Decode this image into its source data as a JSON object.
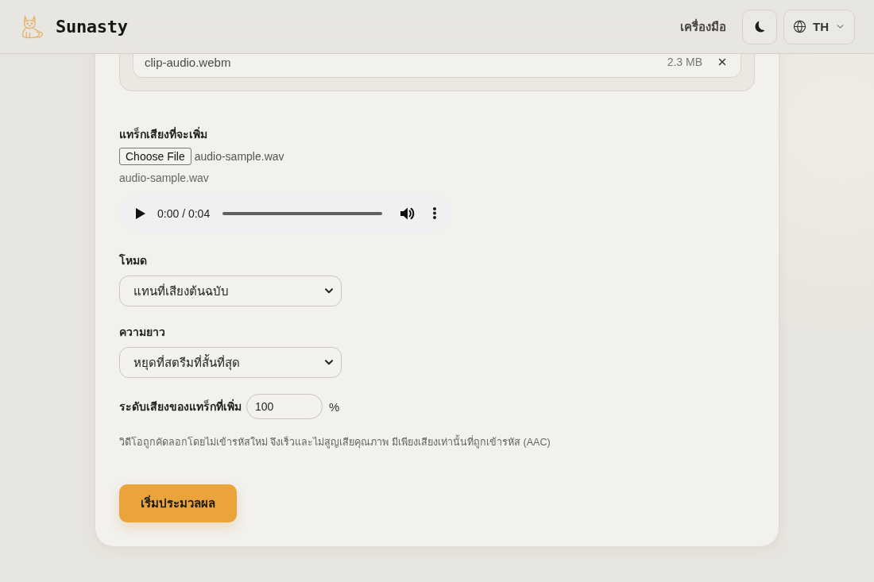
{
  "header": {
    "brand": "Sunasty",
    "nav_link": "เครื่องมือ",
    "language": "TH"
  },
  "attached_file": {
    "name": "clip-audio.webm",
    "size": "2.3 MB"
  },
  "audio_track": {
    "label": "แทร็กเสียงที่จะเพิ่ม",
    "choose_button": "Choose File",
    "chosen_file": "audio-sample.wav",
    "file_name": "audio-sample.wav",
    "player": {
      "time": "0:00 / 0:04"
    }
  },
  "mode": {
    "label": "โหมด",
    "value": "แทนที่เสียงต้นฉบับ"
  },
  "length": {
    "label": "ความยาว",
    "value": "หยุดที่สตรีมที่สั้นที่สุด"
  },
  "track_volume": {
    "label": "ระดับเสียงของแทร็กที่เพิ่ม",
    "value": "100",
    "unit": "%"
  },
  "note": "วิดีโอถูกคัดลอกโดยไม่เข้ารหัสใหม่ จึงเร็วและไม่สูญเสียคุณภาพ มีเพียงเสียงเท่านั้นที่ถูกเข้ารหัส (AAC)",
  "start_button": "เริ่มประมวลผล"
}
